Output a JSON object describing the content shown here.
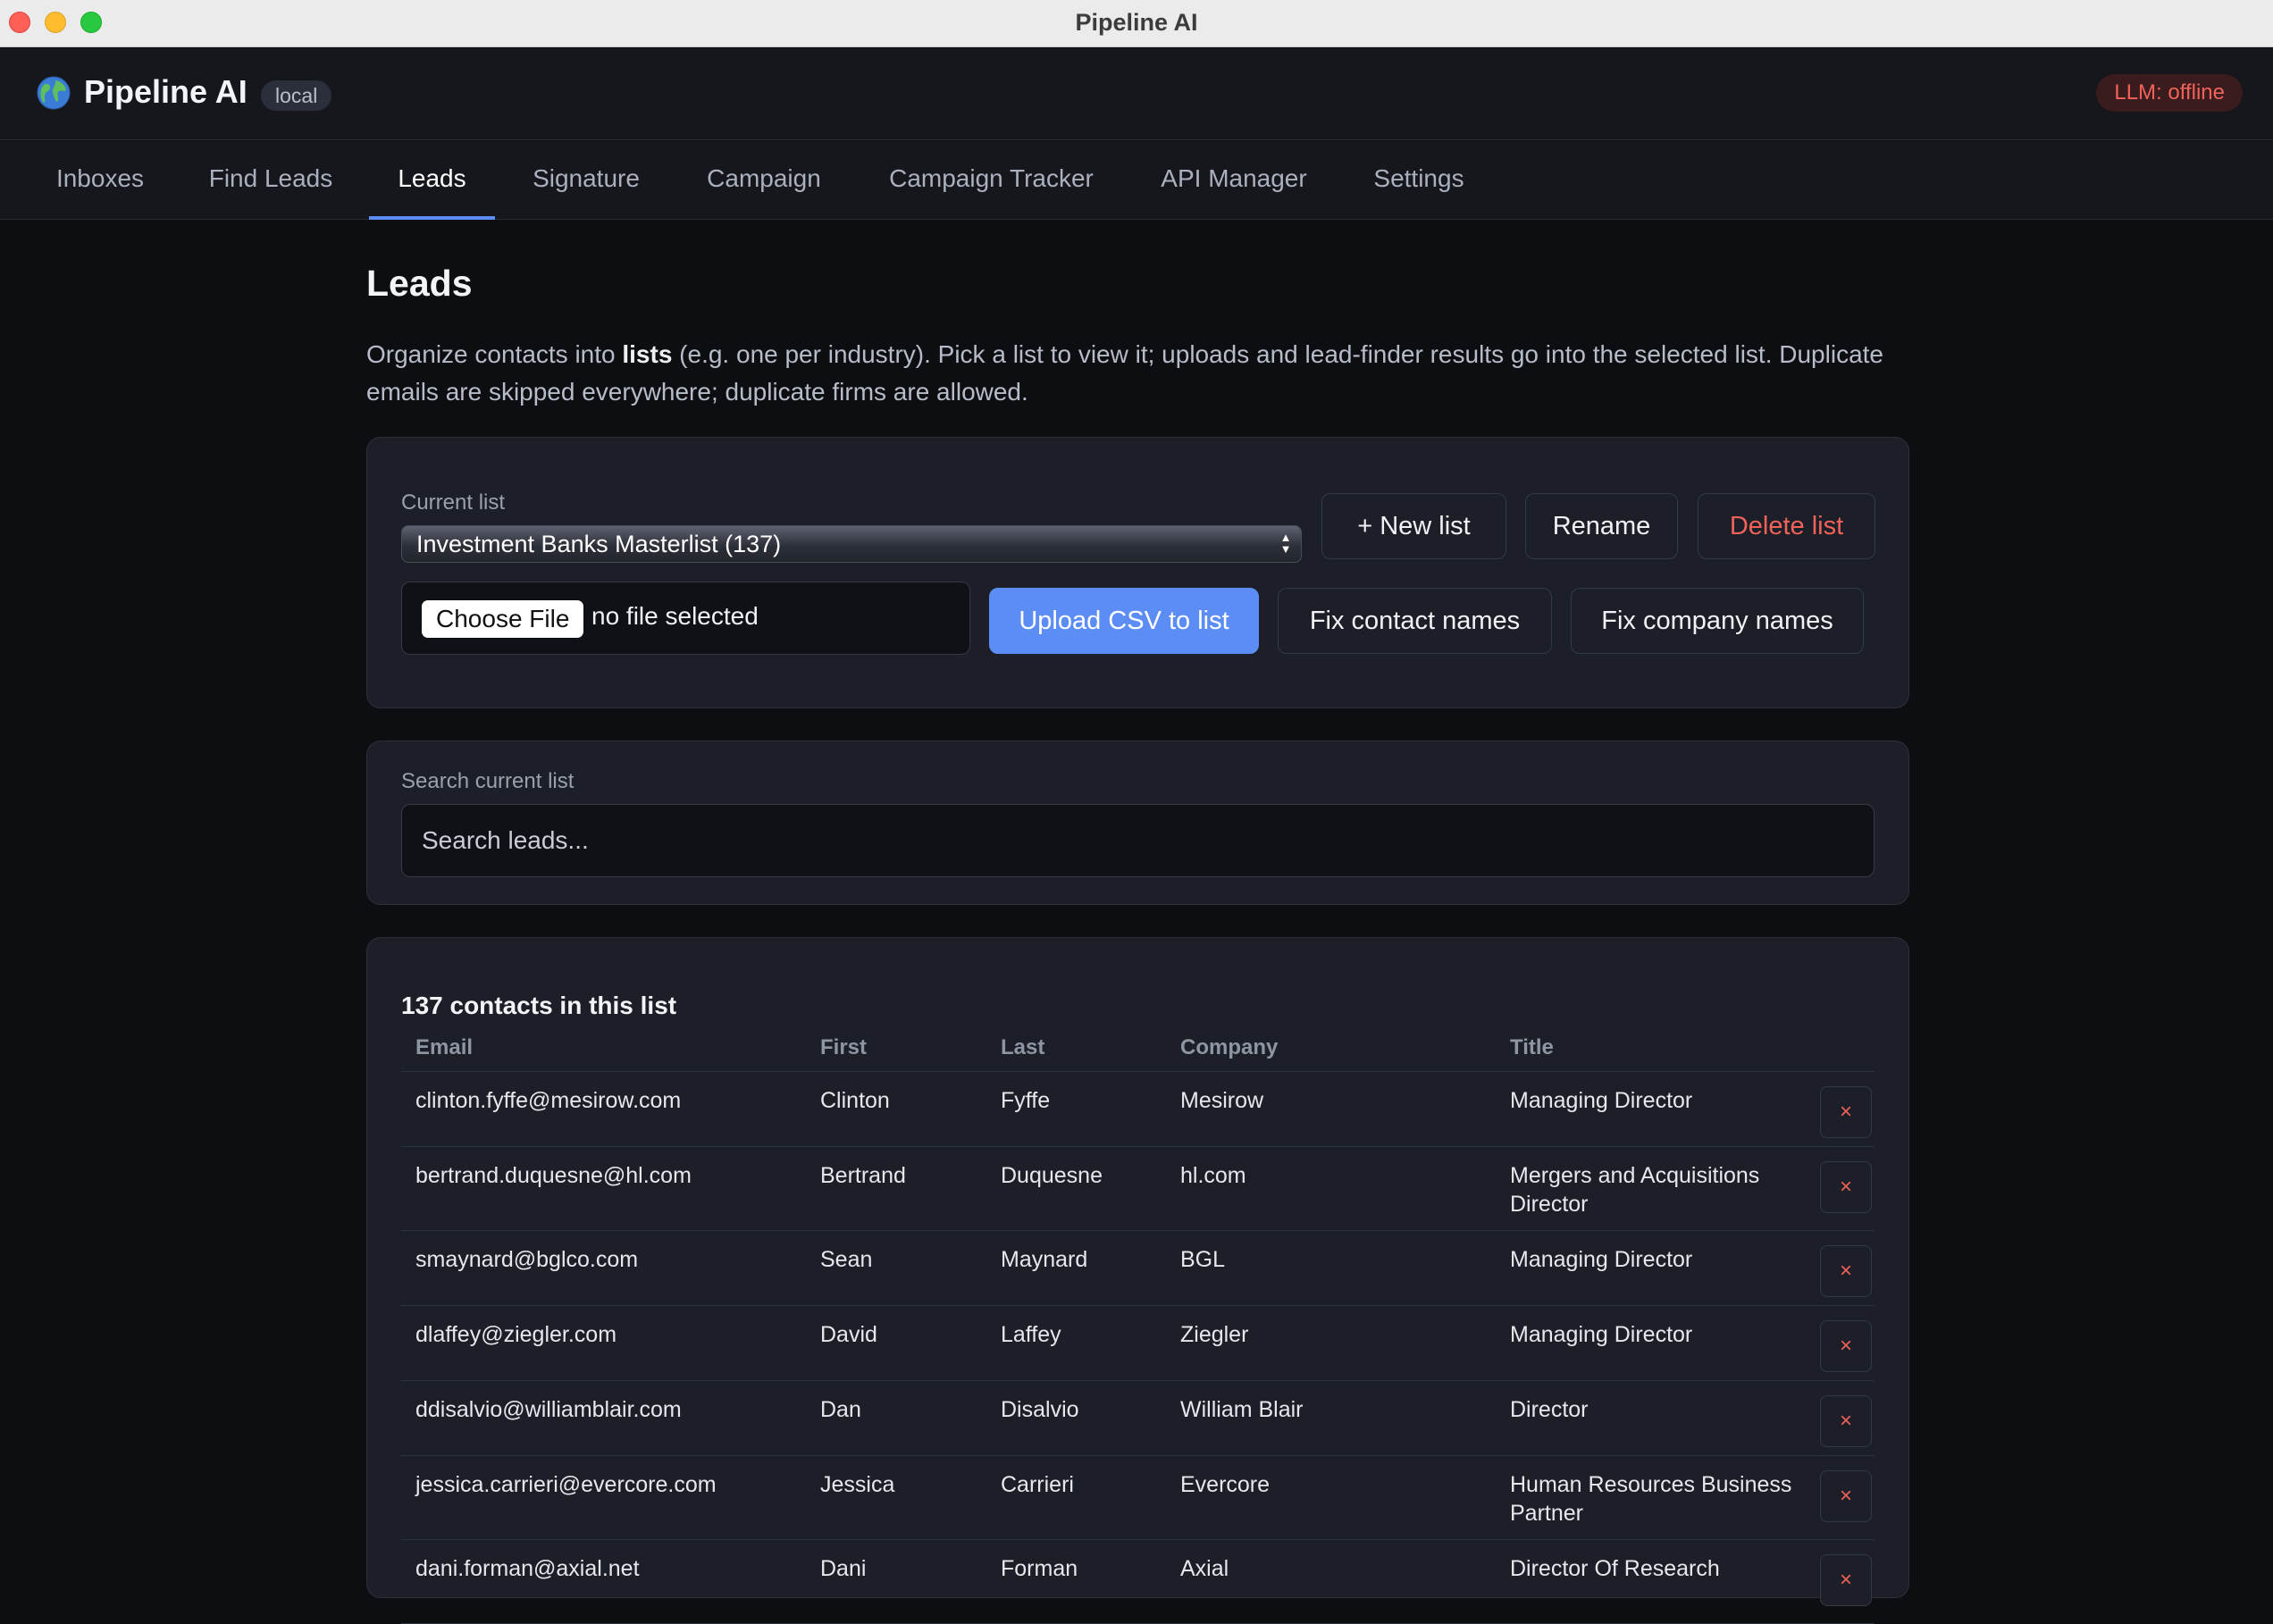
{
  "window": {
    "title": "Pipeline AI"
  },
  "header": {
    "app_name": "Pipeline AI",
    "env_badge": "local",
    "llm_status": "LLM: offline",
    "logo_icon": "globe-icon"
  },
  "nav": {
    "tabs": [
      "Inboxes",
      "Find Leads",
      "Leads",
      "Signature",
      "Campaign",
      "Campaign Tracker",
      "API Manager",
      "Settings"
    ],
    "active": "Leads"
  },
  "page": {
    "title": "Leads",
    "desc_prefix": "Organize contacts into ",
    "desc_bold": "lists",
    "desc_suffix": " (e.g. one per industry). Pick a list to view it; uploads and lead-finder results go into the selected list. Duplicate emails are skipped everywhere; duplicate firms are allowed."
  },
  "list_panel": {
    "current_label": "Current list",
    "selected_list": "Investment Banks Masterlist (137)",
    "new_list": "+ New list",
    "rename": "Rename",
    "delete_list": "Delete list",
    "choose_file": "Choose File",
    "no_file": "no file selected",
    "upload": "Upload CSV to list",
    "fix_contacts": "Fix contact names",
    "fix_companies": "Fix company names"
  },
  "search": {
    "label": "Search current list",
    "placeholder": "Search leads..."
  },
  "table": {
    "count_title": "137 contacts in this list",
    "columns": [
      "Email",
      "First",
      "Last",
      "Company",
      "Title"
    ],
    "delete_glyph": "×",
    "rows": [
      {
        "email": "clinton.fyffe@mesirow.com",
        "first": "Clinton",
        "last": "Fyffe",
        "company": "Mesirow",
        "title": "Managing Director"
      },
      {
        "email": "bertrand.duquesne@hl.com",
        "first": "Bertrand",
        "last": "Duquesne",
        "company": "hl.com",
        "title": "Mergers and Acquisitions Director"
      },
      {
        "email": "smaynard@bglco.com",
        "first": "Sean",
        "last": "Maynard",
        "company": "BGL",
        "title": "Managing Director"
      },
      {
        "email": "dlaffey@ziegler.com",
        "first": "David",
        "last": "Laffey",
        "company": "Ziegler",
        "title": "Managing Director"
      },
      {
        "email": "ddisalvio@williamblair.com",
        "first": "Dan",
        "last": "Disalvio",
        "company": "William Blair",
        "title": "Director"
      },
      {
        "email": "jessica.carrieri@evercore.com",
        "first": "Jessica",
        "last": "Carrieri",
        "company": "Evercore",
        "title": "Human Resources Business Partner"
      },
      {
        "email": "dani.forman@axial.net",
        "first": "Dani",
        "last": "Forman",
        "company": "Axial",
        "title": "Director Of Research"
      }
    ]
  },
  "colors": {
    "accent": "#5b8df5",
    "danger": "#f0625a",
    "background": "#0d0e12",
    "card": "#1c1f27"
  }
}
